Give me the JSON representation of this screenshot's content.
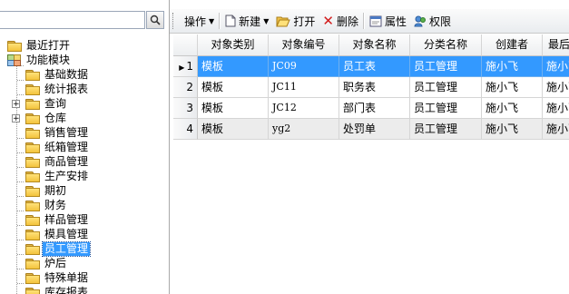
{
  "search": {
    "placeholder": "",
    "value": ""
  },
  "tree": {
    "recent": "最近打开",
    "modules": "功能模块",
    "items": [
      "基础数据",
      "统计报表",
      "查询",
      "仓库",
      "销售管理",
      "纸箱管理",
      "商品管理",
      "生产安排",
      "期初",
      "财务",
      "样品管理",
      "模具管理",
      "员工管理",
      "炉后",
      "特殊单据",
      "库存报表"
    ],
    "selected": "员工管理"
  },
  "toolbar": {
    "operate": "操作",
    "new": "新建",
    "open": "打开",
    "delete": "删除",
    "properties": "属性",
    "permissions": "权限"
  },
  "grid": {
    "columns": [
      "对象类别",
      "对象编号",
      "对象名称",
      "分类名称",
      "创建者",
      "最后"
    ],
    "rows": [
      {
        "num": "1",
        "type": "模板",
        "code": "JC09",
        "name": "员工表",
        "category": "员工管理",
        "creator": "施小飞",
        "last": "施小飞"
      },
      {
        "num": "2",
        "type": "模板",
        "code": "JC11",
        "name": "职务表",
        "category": "员工管理",
        "creator": "施小飞",
        "last": "施小飞"
      },
      {
        "num": "3",
        "type": "模板",
        "code": "JC12",
        "name": "部门表",
        "category": "员工管理",
        "creator": "施小飞",
        "last": "施小飞"
      },
      {
        "num": "4",
        "type": "模板",
        "code": "yg2",
        "name": "处罚单",
        "category": "员工管理",
        "creator": "施小飞",
        "last": "施小飞"
      }
    ]
  },
  "colors": {
    "selection": "#3399ff",
    "header": "#eceef0"
  },
  "icons": {
    "search": "magnifier-icon",
    "new": "new-document-icon",
    "open": "open-folder-icon",
    "delete": "red-x-icon",
    "properties": "properties-icon",
    "permissions": "permissions-icon"
  }
}
